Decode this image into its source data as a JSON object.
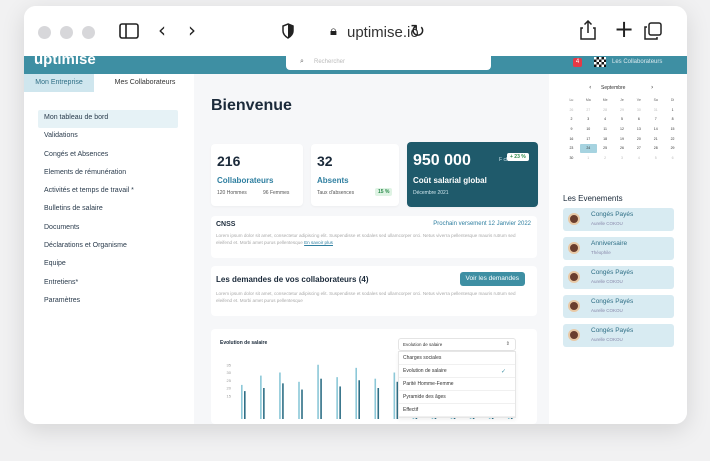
{
  "browser": {
    "url": "uptimise.io"
  },
  "topbar": {
    "logo": "uptimise",
    "search_placeholder": "Rechercher",
    "notif_count": "4",
    "user": "Les Collaborateurs"
  },
  "sidebar": {
    "tabs": [
      "Mon Entreprise",
      "Mes Collaborateurs"
    ],
    "items": [
      "Mon tableau de bord",
      "Validations",
      "Congés et Absences",
      "Elements de rémunération",
      "Activités et temps de travail *",
      "Bulletins de salaire",
      "Documents",
      "Déclarations et Organisme",
      "Equipe",
      "Entretiens*",
      "Paramètres"
    ]
  },
  "main": {
    "welcome": "Bienvenue",
    "cards": {
      "collab": {
        "value": "216",
        "label": "Collaborateurs",
        "sub1": "120 Hommes",
        "sub2": "96 Femmes"
      },
      "absents": {
        "value": "32",
        "label": "Absents",
        "sub": "Taux d'absences",
        "pill": "15 %"
      },
      "salaire": {
        "value": "950 000",
        "unit": "F cfa",
        "badge": "+ 23 %",
        "label": "Coût salarial global",
        "sub": "Décembre 2021"
      }
    },
    "cnss": {
      "title": "CNSS",
      "right": "Prochain versement  12 Janvier 2022",
      "text": "Lorem ipsum dolor sit amet, consectetur adipiscing elit. Suspendisse et sodales sed ullamcorper orci. Netus viverra pellentesque mauris rutrum sed eleifend et. Morbi amet purus pellentesque",
      "link": "En savoir plus"
    },
    "demandes": {
      "title": "Les demandes de vos collaborateurs (4)",
      "button": "Voir les demandes",
      "text": "Lorem ipsum dolor sit amet, consectetur adipiscing elit. Suspendisse et sodales sed ullamcorper orci. Netus viverra pellentesque mauris rutrum sed eleifend et. Morbi amet purus pellentesque"
    },
    "chart": {
      "title": "Evolution de salaire",
      "select_value": "Evolution de salaire",
      "options": [
        "Charges sociales",
        "Evolution de salaire",
        "Parité Homme-Femme",
        "Pyramide des âges",
        "Effectif"
      ],
      "selected_index": 1
    }
  },
  "chart_data": {
    "type": "bar",
    "yticks": [
      "35",
      "30",
      "25",
      "20",
      "15"
    ],
    "series": [
      {
        "values": [
          22,
          28,
          30,
          24,
          35,
          27,
          33,
          26,
          30,
          34,
          29,
          31,
          34,
          32,
          31
        ]
      },
      {
        "values": [
          18,
          20,
          23,
          19,
          26,
          21,
          25,
          20,
          24,
          27,
          22,
          24,
          27,
          25,
          24
        ]
      }
    ],
    "ylim": [
      0,
      40
    ],
    "colors": [
      "#8cc8d8",
      "#2f6f86"
    ]
  },
  "calendar": {
    "month": "Septembre",
    "weekdays": [
      "Lu",
      "Ma",
      "Me",
      "Je",
      "Ve",
      "Sa",
      "Di"
    ],
    "days": [
      "26",
      "27",
      "28",
      "29",
      "30",
      "31",
      "1",
      "2",
      "3",
      "4",
      "5",
      "6",
      "7",
      "8",
      "9",
      "10",
      "11",
      "12",
      "13",
      "14",
      "15",
      "16",
      "17",
      "18",
      "19",
      "20",
      "21",
      "22",
      "23",
      "24",
      "25",
      "26",
      "27",
      "28",
      "29",
      "30",
      "1",
      "2",
      "3",
      "4",
      "5",
      "6"
    ],
    "today_index": 29
  },
  "events": {
    "title": "Les Evenements",
    "items": [
      {
        "title": "Congés Payés",
        "person": "Aurelle COKOU"
      },
      {
        "title": "Anniversaire",
        "person": "Théophile"
      },
      {
        "title": "Congés Payés",
        "person": "Aurelle COKOU"
      },
      {
        "title": "Congés Payés",
        "person": "Aurelle COKOU"
      },
      {
        "title": "Congés Payés",
        "person": "Aurelle COKOU"
      }
    ]
  },
  "colors": {
    "brand": "#3e8fa3",
    "dark_card": "#1f5a6b"
  }
}
